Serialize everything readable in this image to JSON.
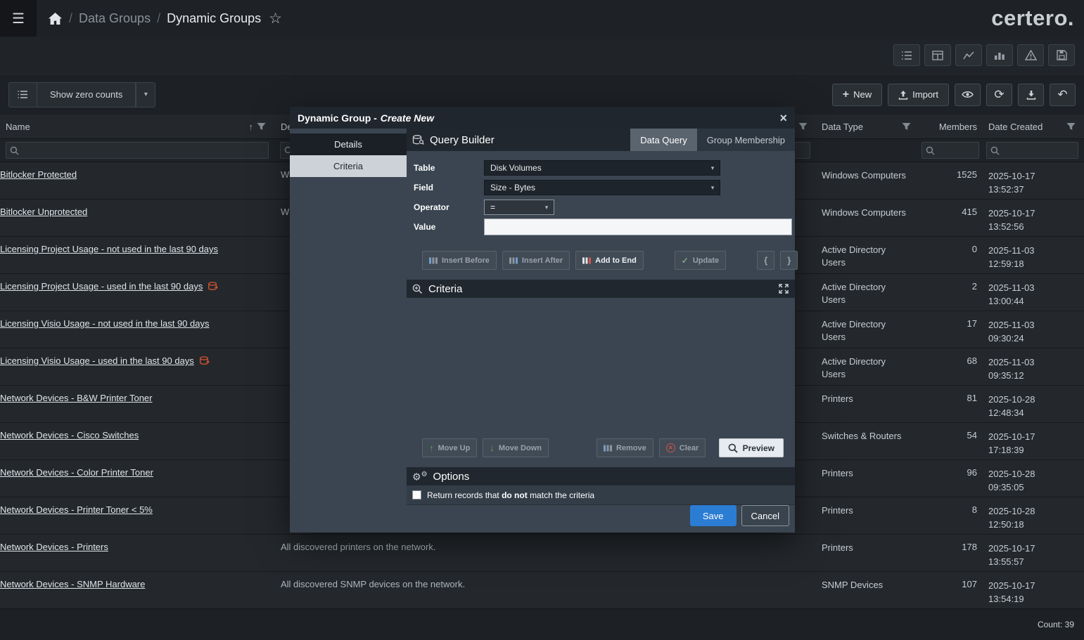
{
  "colors": {
    "accent_blue": "#2b7cd3",
    "flag_red": "#c8502e",
    "success_green": "#56a356",
    "modal_bg": "#3a4551",
    "strip_bg": "#20272f",
    "active_tab_bg": "#5a646f"
  },
  "icons": {
    "hamburger": "☰",
    "star": "☆",
    "caret_down": "▾",
    "plus": "+",
    "refresh": "⟳",
    "undo": "↶",
    "sort_asc": "↑",
    "check": "✓",
    "arrow_up": "↑",
    "arrow_down": "↓",
    "clear_x": "✕",
    "close": "×",
    "gear": "⚙"
  },
  "topbar": {
    "breadcrumb_sep": "/",
    "breadcrumb_parent": "Data Groups",
    "breadcrumb_current": "Dynamic Groups",
    "logo": "certero."
  },
  "list_toolbar": {
    "zero_counts_label": "Show zero counts",
    "new_label": "New",
    "import_label": "Import"
  },
  "table": {
    "headers": {
      "name": "Name",
      "description": "Description",
      "data_type": "Data Type",
      "members": "Members",
      "date_created": "Date Created"
    },
    "count": "Count: 39",
    "rows": [
      {
        "name": "Bitlocker Protected",
        "flagged": false,
        "desc": "W",
        "type": "Windows Computers",
        "members": "1525",
        "date": "2025-10-17",
        "time": "13:52:37"
      },
      {
        "name": "Bitlocker Unprotected",
        "flagged": false,
        "desc": "W",
        "type": "Windows Computers",
        "members": "415",
        "date": "2025-10-17",
        "time": "13:52:56"
      },
      {
        "name": "Licensing Project Usage - not used in the last 90 days",
        "flagged": false,
        "desc": "",
        "type": "Active Directory Users",
        "members": "0",
        "date": "2025-11-03",
        "time": "12:59:18"
      },
      {
        "name": "Licensing Project Usage - used in the last 90 days",
        "flagged": true,
        "desc": "",
        "type": "Active Directory Users",
        "members": "2",
        "date": "2025-11-03",
        "time": "13:00:44"
      },
      {
        "name": "Licensing Visio Usage - not used in the last 90 days",
        "flagged": false,
        "desc": "",
        "type": "Active Directory Users",
        "members": "17",
        "date": "2025-11-03",
        "time": "09:30:24"
      },
      {
        "name": "Licensing Visio Usage - used in the last 90 days",
        "flagged": true,
        "desc": "",
        "type": "Active Directory Users",
        "members": "68",
        "date": "2025-11-03",
        "time": "09:35:12"
      },
      {
        "name": "Network Devices - B&W Printer Toner",
        "flagged": false,
        "desc": "",
        "type": "Printers",
        "members": "81",
        "date": "2025-10-28",
        "time": "12:48:34"
      },
      {
        "name": "Network Devices - Cisco Switches",
        "flagged": false,
        "desc": "",
        "type": "Switches & Routers",
        "members": "54",
        "date": "2025-10-17",
        "time": "17:18:39"
      },
      {
        "name": "Network Devices - Color Printer Toner",
        "flagged": false,
        "desc": "",
        "type": "Printers",
        "members": "96",
        "date": "2025-10-28",
        "time": "09:35:05"
      },
      {
        "name": "Network Devices - Printer Toner < 5%",
        "flagged": false,
        "desc": "",
        "type": "Printers",
        "members": "8",
        "date": "2025-10-28",
        "time": "12:50:18"
      },
      {
        "name": "Network Devices - Printers",
        "flagged": false,
        "desc": "All discovered printers on the network.",
        "type": "Printers",
        "members": "178",
        "date": "2025-10-17",
        "time": "13:55:57"
      },
      {
        "name": "Network Devices - SNMP Hardware",
        "flagged": false,
        "desc": "All discovered SNMP devices on the network.",
        "type": "SNMP Devices",
        "members": "107",
        "date": "2025-10-17",
        "time": "13:54:19"
      }
    ]
  },
  "modal": {
    "title_main": "Dynamic Group -",
    "title_accent": "Create New",
    "nav": {
      "details": "Details",
      "criteria": "Criteria"
    },
    "qb": {
      "title": "Query Builder",
      "tab_data_query": "Data Query",
      "tab_group_membership": "Group Membership",
      "label_table": "Table",
      "label_field": "Field",
      "label_operator": "Operator",
      "label_value": "Value",
      "value_table": "Disk Volumes",
      "value_field": "Size - Bytes",
      "value_operator": "=",
      "value_value": "",
      "btn_insert_before": "Insert Before",
      "btn_insert_after": "Insert After",
      "btn_add_to_end": "Add to End",
      "btn_update": "Update",
      "btn_open_brace": "{",
      "btn_close_brace": "}"
    },
    "criteria": {
      "title": "Criteria",
      "btn_move_up": "Move Up",
      "btn_move_down": "Move Down",
      "btn_remove": "Remove",
      "btn_clear": "Clear",
      "btn_preview": "Preview"
    },
    "options": {
      "title": "Options",
      "checkbox_pre": "Return records that",
      "checkbox_bold": "do not",
      "checkbox_post": "match the criteria"
    },
    "footer": {
      "save": "Save",
      "cancel": "Cancel"
    }
  }
}
